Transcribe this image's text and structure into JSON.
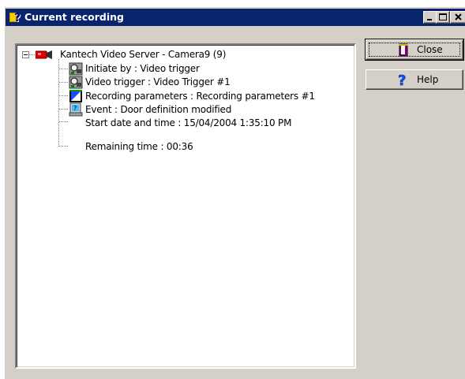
{
  "window": {
    "title": "Current recording",
    "icon": "recording-help-icon"
  },
  "tree": {
    "root": {
      "label": "Kantech Video Server  -  Camera9 (9)",
      "icon": "camera-icon",
      "expanded": true
    },
    "children": [
      {
        "label": "Initiate by : Video trigger",
        "icon": "video-trigger-icon"
      },
      {
        "label": "Video trigger : Video Trigger #1",
        "icon": "video-trigger-icon"
      },
      {
        "label": "Recording parameters : Recording parameters #1",
        "icon": "recording-parameters-icon"
      },
      {
        "label": "Event : Door definition modified",
        "icon": "event-icon"
      },
      {
        "label": "Start date and time : 15/04/2004 1:35:10 PM",
        "icon": ""
      },
      {
        "label": "Remaining time : 00:36",
        "icon": ""
      }
    ]
  },
  "buttons": {
    "close": "Close",
    "help": "Help"
  },
  "colors": {
    "titlebar": "#08246b",
    "face": "#d4d0c8"
  }
}
